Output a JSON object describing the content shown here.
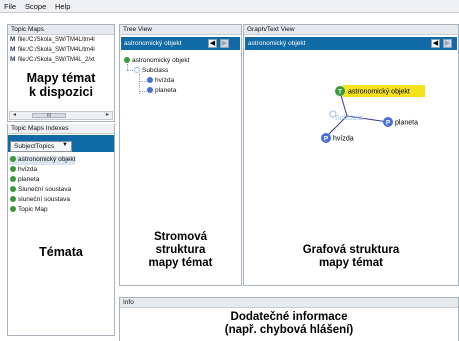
{
  "menu": [
    "File",
    "Scope",
    "Help"
  ],
  "topic_maps": {
    "header": "Topic Maps",
    "files": [
      "file:/C:/Škola_SW/TM4L/tm4l",
      "file:/C:/Škola_SW/TM4L/tm4l",
      "file:/C:/Škola_SW/TM4L_2/xt"
    ],
    "icon": "topic-map-icon",
    "scroll_thumb": "III",
    "annotation_line1": "Mapy témat",
    "annotation_line2": "k dispozici"
  },
  "indexes": {
    "header": "Topic Maps Indexes",
    "dropdown_value": "SubjectTopics",
    "topics": [
      "astronomický objekt",
      "hvízda",
      "planeta",
      "Sluneční soustava",
      "sluneční soustava",
      "Topic Map"
    ],
    "selected_index": 0,
    "annotation": "Témata"
  },
  "tree_view": {
    "header": "Tree View",
    "bar_title": "astronomický objekt",
    "root": "astronomický objekt",
    "relation": "Subclass",
    "children": [
      "hvízda",
      "planeta"
    ],
    "annotation_line1": "Stromová",
    "annotation_line2": "struktura",
    "annotation_line3": "mapy témat"
  },
  "graph_view": {
    "header": "Graph/Text View",
    "bar_title": "astronomický objekt",
    "center_node": "astronomický objekt",
    "center_letter": "T",
    "relation_node": "Subclass",
    "child_nodes": [
      {
        "label": "planeta",
        "letter": "P"
      },
      {
        "label": "hvízda",
        "letter": "P"
      }
    ],
    "annotation_line1": "Grafová struktura",
    "annotation_line2": "mapy témat"
  },
  "info": {
    "header": "Info",
    "annotation_line1": "Dodatečné informace",
    "annotation_line2": "(např. chybová hlášení)"
  },
  "colors": {
    "accent_bar": "#0f6aa5",
    "topic_green": "#3a9a3a",
    "topic_blue": "#4a6fd0",
    "highlight_yellow": "#f4e21c",
    "relation_light": "#9cc0e6"
  },
  "icons": [
    "back-arrow-icon",
    "forward-arrow-icon",
    "topic-bullet-icon",
    "dropdown-arrow-icon"
  ]
}
